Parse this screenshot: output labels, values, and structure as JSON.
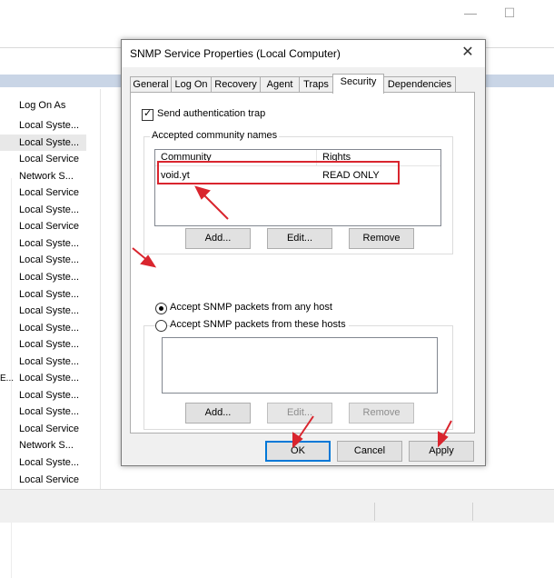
{
  "background_window": {
    "column_header": "Log On As",
    "rows": [
      "Local Syste...",
      "Local Syste...",
      "Local Service",
      "Network S...",
      "Local Service",
      "Local Syste...",
      "Local Service",
      "Local Syste...",
      "Local Syste...",
      "Local Syste...",
      "Local Syste...",
      "Local Syste...",
      "Local Syste...",
      "Local Syste...",
      "Local Syste...",
      "Local Syste...",
      "Local Syste...",
      "Local Syste...",
      "Local Service",
      "Network S...",
      "Local Syste...",
      "Local Service"
    ],
    "stub_char": "E...",
    "minimize_glyph": "—",
    "maximize_glyph": "☐"
  },
  "dialog": {
    "title": "SNMP Service Properties (Local Computer)",
    "close_glyph": "✕",
    "tabs": [
      {
        "label": "General"
      },
      {
        "label": "Log On"
      },
      {
        "label": "Recovery"
      },
      {
        "label": "Agent"
      },
      {
        "label": "Traps"
      },
      {
        "label": "Security",
        "active": true
      },
      {
        "label": "Dependencies"
      }
    ],
    "send_auth_trap": {
      "label": "Send authentication trap",
      "checked": true,
      "check_glyph": "✓"
    },
    "community_group": {
      "legend": "Accepted community names",
      "columns": [
        "Community",
        "Rights"
      ],
      "rows": [
        {
          "community": "void.yt",
          "rights": "READ ONLY"
        }
      ],
      "buttons": {
        "add": "Add...",
        "edit": "Edit...",
        "remove": "Remove"
      }
    },
    "accept_any": {
      "label": "Accept SNMP packets from any host",
      "selected": true
    },
    "accept_these": {
      "label": "Accept SNMP packets from these hosts",
      "selected": false
    },
    "hosts_buttons": {
      "add": "Add...",
      "edit": "Edit...",
      "remove": "Remove"
    },
    "footer": {
      "ok": "OK",
      "cancel": "Cancel",
      "apply": "Apply"
    }
  },
  "colors": {
    "annotation": "#d9252e",
    "accent": "#0078d7"
  }
}
